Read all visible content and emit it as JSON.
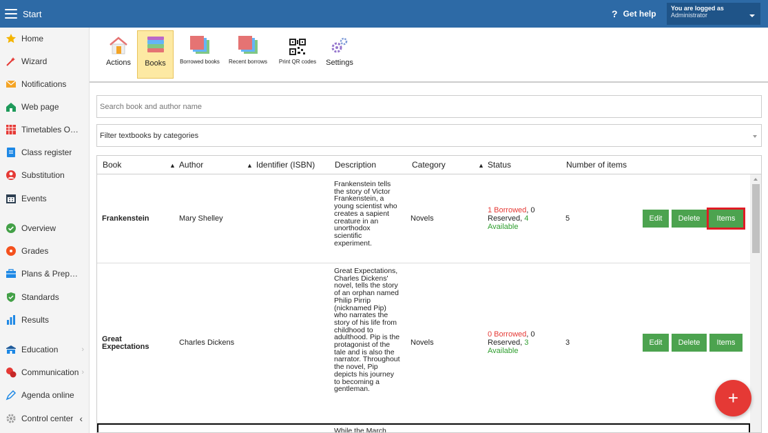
{
  "topbar": {
    "title": "Start",
    "help": "Get help",
    "user_line1": "You are logged as",
    "user_line2": "Administrator"
  },
  "sidebar": {
    "items": [
      {
        "label": "Home",
        "icon": "star-icon"
      },
      {
        "label": "Wizard",
        "icon": "wand-icon"
      },
      {
        "label": "Notifications",
        "icon": "envelope-icon"
      },
      {
        "label": "Web page",
        "icon": "house-icon"
      },
      {
        "label": "Timetables Onl...",
        "icon": "calendar-grid-icon"
      },
      {
        "label": "Class register",
        "icon": "register-icon"
      },
      {
        "label": "Substitution",
        "icon": "person-icon"
      },
      {
        "label": "Events",
        "icon": "events-calendar-icon"
      },
      {
        "label": "Overview",
        "icon": "check-circle-icon"
      },
      {
        "label": "Grades",
        "icon": "grades-circle-icon"
      },
      {
        "label": "Plans & Prepar...",
        "icon": "briefcase-icon"
      },
      {
        "label": "Standards",
        "icon": "shield-check-icon"
      },
      {
        "label": "Results",
        "icon": "bar-chart-icon"
      },
      {
        "label": "Education",
        "icon": "school-icon"
      },
      {
        "label": "Communication",
        "icon": "chat-icon"
      },
      {
        "label": "Agenda online",
        "icon": "pen-icon"
      },
      {
        "label": "Control center",
        "icon": "gear-icon"
      }
    ]
  },
  "toolbar": {
    "actions": "Actions",
    "books": "Books",
    "borrowed": "Borrowed books",
    "recent": "Recent borrows",
    "qr": "Print QR codes",
    "settings": "Settings"
  },
  "search": {
    "placeholder": "Search book and author name"
  },
  "filter": {
    "label": "Filter textbooks by categories"
  },
  "table": {
    "headers": {
      "book": "Book",
      "author": "Author",
      "isbn": "Identifier (ISBN)",
      "description": "Description",
      "category": "Category",
      "status": "Status",
      "items": "Number of items"
    },
    "rows": [
      {
        "book": "Frankenstein",
        "author": "Mary Shelley",
        "description_lines": [
          "Frankenstein tells",
          "the story of Victor",
          "Frankenstein, a",
          "young scientist who",
          "creates a sapient",
          "creature in an",
          "unorthodox",
          "scientific",
          "experiment."
        ],
        "category": "Novels",
        "borrowed": "1 Borrowed",
        "reserved_a": ", 0",
        "reserved_b": "Reserved, ",
        "available_n": "4",
        "available": "Available",
        "count": "5"
      },
      {
        "book": "Great Expectations",
        "book_line1": "Great",
        "book_line2": "Expectations",
        "author": "Charles Dickens",
        "description_lines": [
          "Great Expectations,",
          "Charles Dickens'",
          "novel, tells the story",
          "of an orphan named",
          "Philip Pirrip",
          "(nicknamed Pip)",
          "who narrates the",
          "story of his life from",
          "childhood to",
          "adulthood. Pip is the",
          "protagonist of the",
          "tale and is also the",
          "narrator. Throughout",
          "the novel, Pip",
          "depicts his journey",
          "to becoming a",
          "gentleman."
        ],
        "category": "Novels",
        "borrowed": "0 Borrowed",
        "reserved_a": ", 0",
        "reserved_b": "Reserved, ",
        "available_n": "3",
        "available": "Available",
        "count": "3"
      }
    ],
    "row3_desc": "While the March",
    "buttons": {
      "edit": "Edit",
      "delete": "Delete",
      "items": "Items"
    }
  },
  "fab": {
    "label": "+"
  }
}
